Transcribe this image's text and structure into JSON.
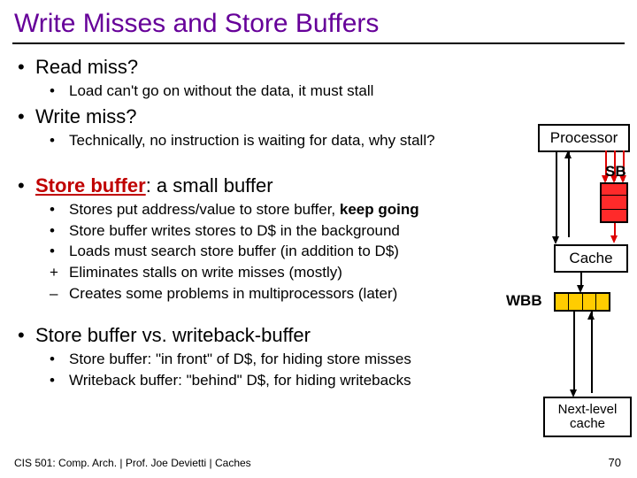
{
  "title": "Write Misses and Store Buffers",
  "bullets": {
    "read_miss": "Read miss?",
    "read_miss_sub": "Load can't go on without the data, it must stall",
    "write_miss": "Write miss?",
    "write_miss_sub": "Technically, no instruction is waiting for data, why stall?",
    "store_buffer_label": "Store buffer",
    "store_buffer_rest": ": a small buffer",
    "sb1a": "Stores put address/value to store buffer, ",
    "sb1b": "keep going",
    "sb2": "Store buffer writes stores to D$ in the background",
    "sb3": "Loads must search store buffer (in addition to D$)",
    "sb4": "Eliminates stalls on write misses (mostly)",
    "sb5": "Creates some problems in multiprocessors (later)",
    "sb_vs_wb": "Store buffer vs. writeback-buffer",
    "sb_vs_wb_sub1": "Store buffer: \"in front\" of D$, for hiding store misses",
    "sb_vs_wb_sub2": "Writeback buffer: \"behind\" D$, for hiding writebacks"
  },
  "diagram": {
    "processor": "Processor",
    "sb": "SB",
    "cache": "Cache",
    "wbb": "WBB",
    "next_level": "Next-level cache"
  },
  "footer": "CIS 501: Comp. Arch.  |  Prof. Joe Devietti  |  Caches",
  "page": "70"
}
